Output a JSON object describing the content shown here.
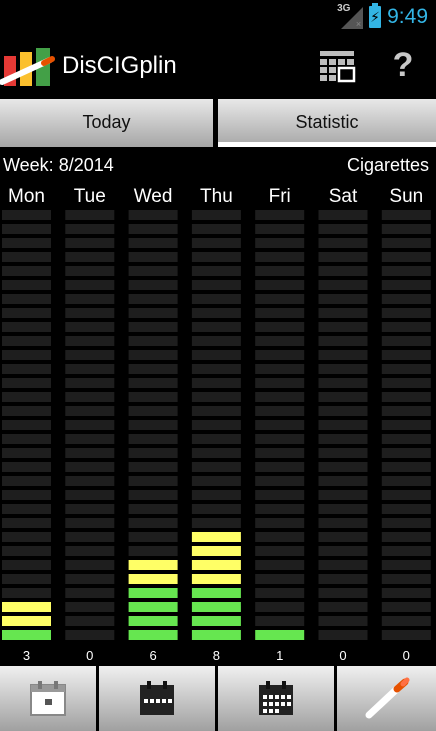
{
  "status_bar": {
    "network": "3G",
    "time": "9:49",
    "colors": {
      "accent": "#33b5e5"
    }
  },
  "app": {
    "title": "DisCIGplin"
  },
  "actions": {
    "calendar_icon": "calendar-grid-icon",
    "help_icon": "help-icon",
    "help_glyph": "?"
  },
  "tabs": [
    {
      "label": "Today"
    },
    {
      "label": "Statistic"
    }
  ],
  "stat": {
    "week_label": "Week: 8/2014",
    "units_label": "Cigarettes"
  },
  "chart_data": {
    "type": "bar",
    "categories": [
      "Mon",
      "Tue",
      "Wed",
      "Thu",
      "Fri",
      "Sat",
      "Sun"
    ],
    "values": [
      3,
      0,
      6,
      8,
      1,
      0,
      0
    ],
    "segments_total": 31,
    "colors": {
      "empty": "#1e1e1e",
      "green": "#66e650",
      "yellow": "#ffff66"
    }
  },
  "bottom_nav": [
    {
      "icon": "day-calendar-icon"
    },
    {
      "icon": "week-calendar-icon"
    },
    {
      "icon": "month-calendar-icon"
    },
    {
      "icon": "cigarette-icon"
    }
  ]
}
